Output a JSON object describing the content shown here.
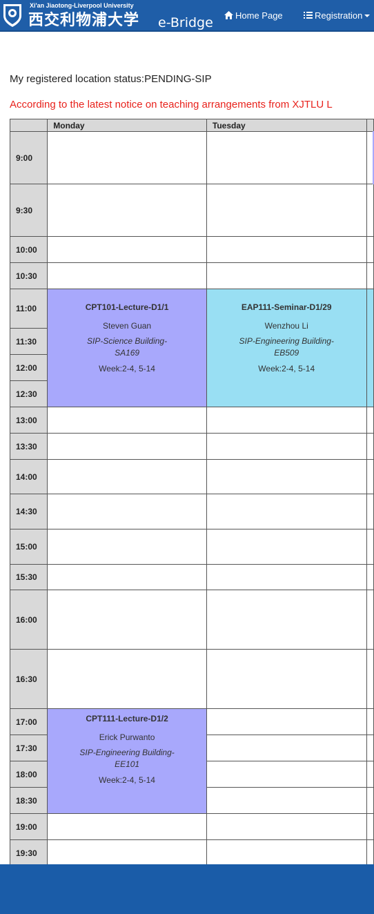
{
  "navbar": {
    "brand_en": "Xi'an Jiaotong-Liverpool University",
    "brand_cn": "西交利物浦大学",
    "brand_product": "e-Bridge",
    "home_label": "Home Page",
    "registration_label": "Registration",
    "home_icon": "home-icon",
    "registration_icon": "list-icon"
  },
  "status": {
    "label": "My registered location status:",
    "value": "PENDING-SIP"
  },
  "notice": "According to the latest notice on teaching arrangements from XJTLU L",
  "timetable": {
    "days": [
      "Monday",
      "Tuesday"
    ],
    "times": [
      "9:00",
      "9:30",
      "10:00",
      "10:30",
      "11:00",
      "11:30",
      "12:00",
      "12:30",
      "13:00",
      "13:30",
      "14:00",
      "14:30",
      "15:00",
      "15:30",
      "16:00",
      "16:30",
      "17:00",
      "17:30",
      "18:00",
      "18:30",
      "19:00",
      "19:30"
    ],
    "events": [
      {
        "day": "Monday",
        "start": "11:00",
        "title": "CPT101-Lecture-D1/1",
        "teacher": "Steven Guan",
        "room": "SIP-Science Building-SA169",
        "week": "Week:2-4, 5-14",
        "color": "#a8a8fc"
      },
      {
        "day": "Tuesday",
        "start": "11:00",
        "title": "EAP111-Seminar-D1/29",
        "teacher": "Wenzhou Li",
        "room": "SIP-Engineering Building-EB509",
        "week": "Week:2-4, 5-14",
        "color": "#99dff3"
      },
      {
        "day": "Monday",
        "start": "17:00",
        "title": "CPT111-Lecture-D1/2",
        "teacher": "Erick Purwanto",
        "room": "SIP-Engineering Building-EE101",
        "week": "Week:2-4, 5-14",
        "color": "#a8a8fc"
      }
    ]
  },
  "colors": {
    "navbar": "#1f5ea8",
    "notice": "#e8221c",
    "header_bg": "#d9d9d9",
    "footer": "#1a5ca8"
  }
}
